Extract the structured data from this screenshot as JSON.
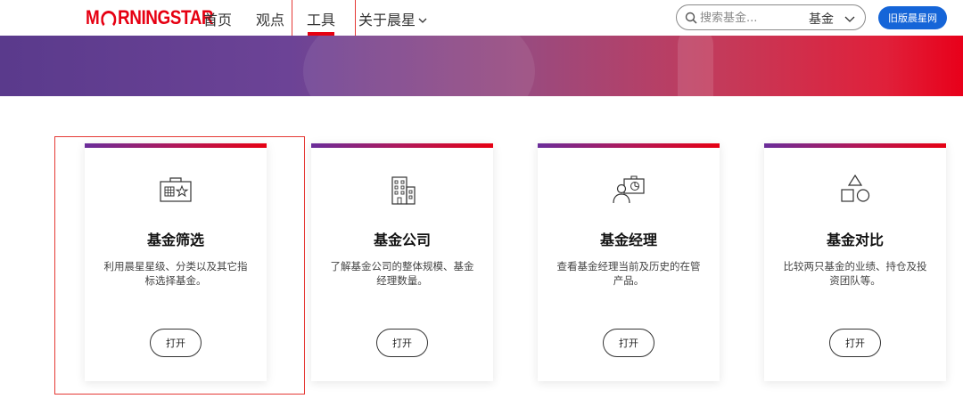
{
  "header": {
    "logo": {
      "left": "M",
      "right": "RNINGSTAR"
    },
    "nav": [
      {
        "label": "首页"
      },
      {
        "label": "观点"
      },
      {
        "label": "工具"
      },
      {
        "label": "关于晨星",
        "has_dropdown": true
      }
    ],
    "search": {
      "placeholder": "搜索基金...",
      "scope": "基金"
    },
    "old_site_label": "旧版晨星网",
    "accent_color": "#e60012",
    "button_color": "#1565d8"
  },
  "cards": [
    {
      "icon": "fund-screener-icon",
      "title": "基金筛选",
      "desc": "利用晨星星级、分类以及其它指标选择基金。",
      "button": "打开"
    },
    {
      "icon": "fund-company-icon",
      "title": "基金公司",
      "desc": "了解基金公司的整体规模、基金经理数量。",
      "button": "打开"
    },
    {
      "icon": "fund-manager-icon",
      "title": "基金经理",
      "desc": "查看基金经理当前及历史的在管产品。",
      "button": "打开"
    },
    {
      "icon": "fund-compare-icon",
      "title": "基金对比",
      "desc": "比较两只基金的业绩、持仓及投资团队等。",
      "button": "打开"
    }
  ]
}
